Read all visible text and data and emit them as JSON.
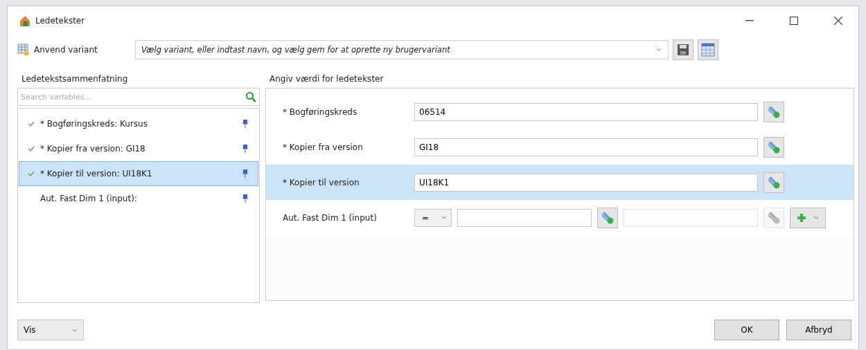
{
  "window": {
    "title": "Ledetekster"
  },
  "variant": {
    "label": "Anvend variant",
    "placeholder": "Vælg variant, eller indtast navn, og vælg gem for at oprette ny brugervariant"
  },
  "summary": {
    "title": "Ledetekstsammenfatning",
    "search": {
      "placeholder": "Search variables..."
    },
    "items": [
      {
        "label": "* Bogføringskreds: Kursus",
        "done": true,
        "selected": false
      },
      {
        "label": "* Kopier fra version: GI18",
        "done": true,
        "selected": false
      },
      {
        "label": "* Kopier til version: UI18K1",
        "done": true,
        "selected": true
      },
      {
        "label": "Aut. Fast Dim 1 (input):",
        "done": false,
        "selected": false
      }
    ]
  },
  "prompts": {
    "title": "Angiv værdi for ledetekster",
    "rows": [
      {
        "kind": "field",
        "label": "* Bogføringskreds",
        "value": "06514",
        "selected": false
      },
      {
        "kind": "field",
        "label": "* Kopier fra version",
        "value": "GI18",
        "selected": false
      },
      {
        "kind": "field",
        "label": "* Kopier til version",
        "value": "UI18K1",
        "selected": true
      },
      {
        "kind": "range",
        "label": "Aut. Fast Dim 1 (input)",
        "operator": "=",
        "selected": false
      }
    ]
  },
  "footer": {
    "view": "Vis",
    "buttons": [
      "OK",
      "Afbryd"
    ]
  }
}
